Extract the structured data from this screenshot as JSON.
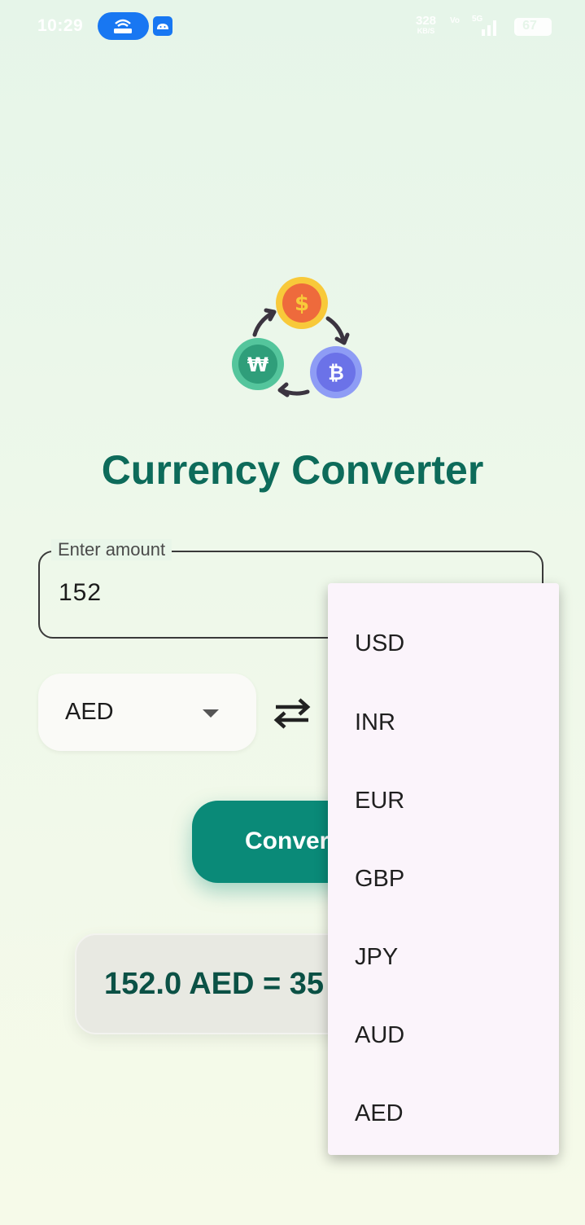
{
  "status_bar": {
    "time": "10:29",
    "net_speed_value": "328",
    "net_speed_unit": "KB/S",
    "volte": "Vo",
    "network": "5G",
    "battery": "67"
  },
  "app": {
    "title": "Currency Converter",
    "colors": {
      "primary": "#0a8a78",
      "title": "#0d6b5a"
    }
  },
  "amount_input": {
    "label": "Enter amount",
    "value": "152"
  },
  "from_currency": {
    "selected": "AED"
  },
  "convert_button": {
    "label": "Convert"
  },
  "result": {
    "text": "152.0 AED = 35"
  },
  "dropdown": {
    "options": [
      "USD",
      "INR",
      "EUR",
      "GBP",
      "JPY",
      "AUD",
      "AED"
    ]
  },
  "icons": {
    "logo": "currency-exchange-logo-icon",
    "swap": "swap-arrows-icon",
    "caret": "caret-down-icon"
  }
}
